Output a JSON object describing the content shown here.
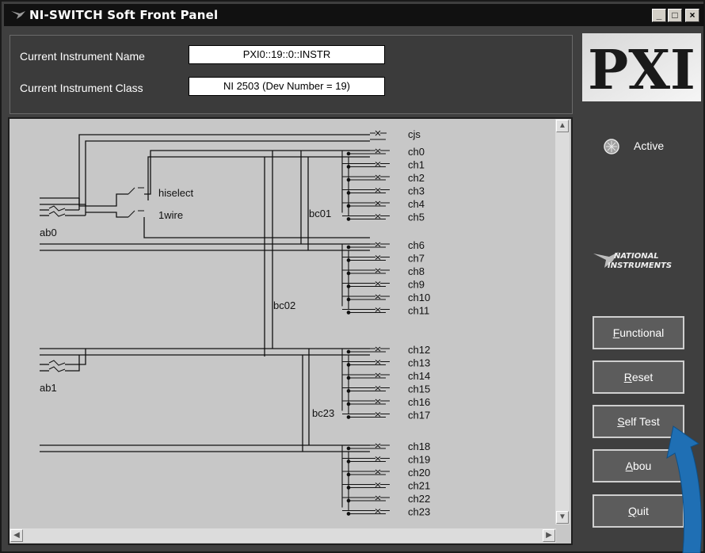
{
  "window": {
    "title": "NI-SWITCH Soft Front Panel",
    "minimize": "_",
    "maximize": "□",
    "close": "×"
  },
  "instrument": {
    "name_label": "Current Instrument Name",
    "name_value": "PXI0::19::0::INSTR",
    "class_label": "Current Instrument Class",
    "class_value": "NI 2503 (Dev Number = 19)"
  },
  "status": {
    "active_label": "Active"
  },
  "brand": {
    "pxi": "PXI",
    "ni_line1": "NATIONAL",
    "ni_line2": "INSTRUMENTS"
  },
  "buttons": {
    "functional": {
      "accel": "F",
      "rest": "unctional"
    },
    "reset": {
      "accel": "R",
      "rest": "eset"
    },
    "self_test": {
      "accel": "S",
      "rest": "elf Test"
    },
    "about": {
      "accel": "A",
      "rest": "bou"
    },
    "quit": {
      "accel": "Q",
      "rest": "uit"
    }
  },
  "schematic": {
    "cjs": "cjs",
    "hiselect": "hiselect",
    "onewire": "1wire",
    "ab0": "ab0",
    "ab1": "ab1",
    "bc01": "bc01",
    "bc02": "bc02",
    "bc23": "bc23",
    "channels": [
      "ch0",
      "ch1",
      "ch2",
      "ch3",
      "ch4",
      "ch5",
      "ch6",
      "ch7",
      "ch8",
      "ch9",
      "ch10",
      "ch11",
      "ch12",
      "ch13",
      "ch14",
      "ch15",
      "ch16",
      "ch17",
      "ch18",
      "ch19",
      "ch20",
      "ch21",
      "ch22",
      "ch23"
    ]
  },
  "colors": {
    "window_bg": "#3f3f3f",
    "schematic_bg": "#c7c7c7",
    "arrow": "#1f6fb4",
    "title_bg": "#111111"
  }
}
